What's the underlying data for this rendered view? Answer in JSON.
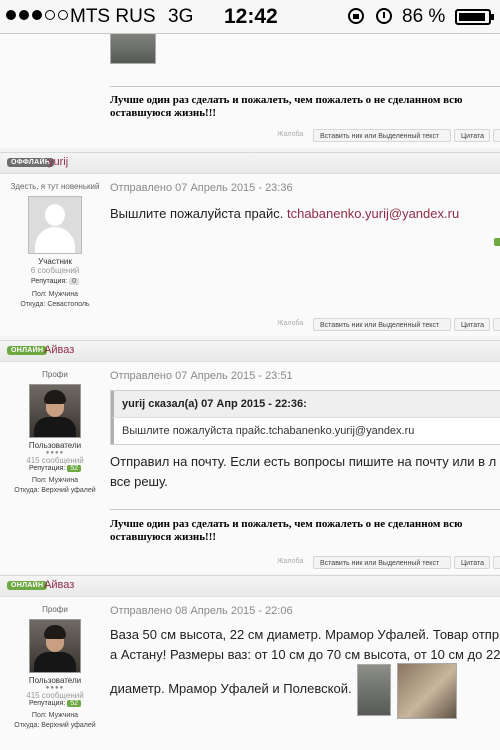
{
  "status_bar": {
    "carrier": "MTS RUS",
    "network": "3G",
    "time": "12:42",
    "battery_percent": "86 %",
    "signal_bars": 3
  },
  "posts": [
    {
      "signature": [
        "Лучше один раз сделать и пожалеть, чем пожалеть о не сделанном всю",
        "оставшуюся жизнь!!!"
      ],
      "actions": {
        "report": "Жалоба",
        "insert_nick": "Вставить ник или Выделенный текст",
        "quote": "Цитата"
      }
    },
    {
      "status_badge": "ОФФЛАЙН",
      "username": "yurij",
      "member_title": "Здесть, я тут новенький",
      "group": "Участник",
      "post_count": "6 сообщений",
      "reputation_label": "Репутация:",
      "reputation_value": "0",
      "gender": "Пол: Мужчина",
      "location": "Откуда: Севастополь",
      "posted": "Отправлено 07 Апрель 2015 - 23:36",
      "text": "Вышлите пожалуйста прайс. ",
      "link": "tchabanenko.yurij@yandex.ru",
      "actions": {
        "report": "Жалоба",
        "insert_nick": "Вставить ник или Выделенный текст",
        "quote": "Цитата"
      }
    },
    {
      "status_badge": "ОНЛАЙН",
      "username": "Айваз",
      "member_title": "Профи",
      "group": "Пользователи",
      "post_count": "415 сообщений",
      "reputation_label": "Репутация:",
      "reputation_value": "52",
      "gender": "Пол: Мужчина",
      "location": "Откуда: Верхний уфалей",
      "posted": "Отправлено 07 Апрель 2015 - 23:51",
      "quote_header": "yurij сказал(а) 07 Апр 2015 - 22:36:",
      "quote_body": "Вышлите пожалуйста прайс.tchabanenko.yurij@yandex.ru",
      "text_lines": [
        "Отправил на почту. Если есть вопросы пишите на почту или в л",
        "все решу."
      ],
      "signature": [
        "Лучше один раз сделать и пожалеть, чем пожалеть о не сделанном всю",
        "оставшуюся жизнь!!!"
      ],
      "actions": {
        "report": "Жалоба",
        "insert_nick": "Вставить ник или Выделенный текст",
        "quote": "Цитата"
      }
    },
    {
      "status_badge": "ОНЛАЙН",
      "username": "Айваз",
      "member_title": "Профи",
      "group": "Пользователи",
      "post_count": "415 сообщений",
      "reputation_label": "Репутация:",
      "reputation_value": "52",
      "gender": "Пол: Мужчина",
      "location": "Откуда: Верхний уфалей",
      "posted": "Отправлено 08 Апрель 2015 - 22:06",
      "text_lines": [
        "Ваза 50 см высота, 22 см диаметр. Мрамор Уфалей. Товар отпр",
        "а Астану! Размеры ваз: от 10 см до 70 см высота, от 10 см до 22",
        "диаметр. Мрамор Уфалей и Полевской."
      ]
    }
  ],
  "colors": {
    "link": "#902c48",
    "online": "#6ea843",
    "offline": "#6d6d6d"
  }
}
